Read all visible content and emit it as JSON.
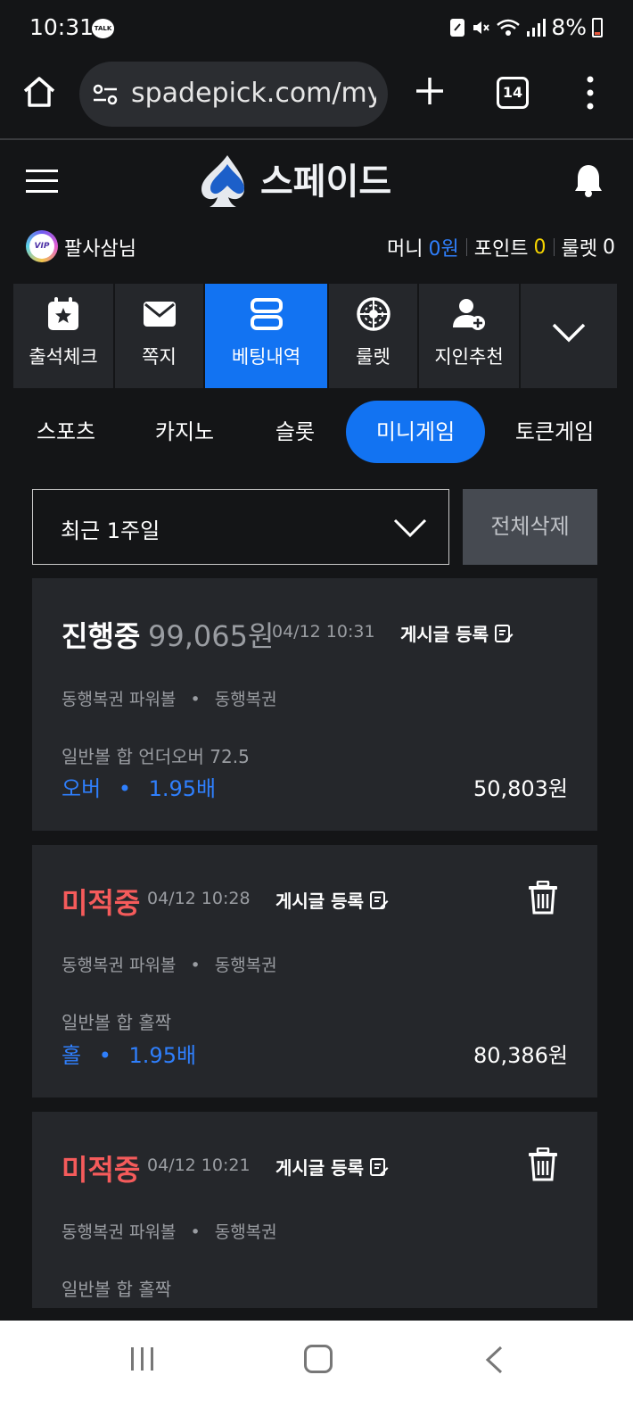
{
  "status_bar": {
    "time": "10:31",
    "talk_badge": "TALK",
    "battery": "8%"
  },
  "browser": {
    "url": "spadepick.com/my/l",
    "tab_count": "14"
  },
  "header": {
    "logo_text": "스페이드"
  },
  "user": {
    "vip_label": "VIP",
    "name": "팔사삼님",
    "money_label": "머니",
    "money_value": "0원",
    "points_label": "포인트",
    "points_value": "0",
    "roulette_label": "룰렛",
    "roulette_value": "0"
  },
  "quick_nav": {
    "items": [
      {
        "label": "출석체크",
        "icon": "calendar-star-icon"
      },
      {
        "label": "쪽지",
        "icon": "envelope-icon"
      },
      {
        "label": "베팅내역",
        "icon": "bet-history-icon",
        "active": true
      },
      {
        "label": "룰렛",
        "icon": "roulette-icon"
      },
      {
        "label": "지인추천",
        "icon": "add-user-icon"
      }
    ],
    "more_icon": "chevron-down-icon"
  },
  "sub_tabs": {
    "items": [
      "스포츠",
      "카지노",
      "슬롯",
      "미니게임",
      "토큰게임"
    ],
    "active": "미니게임"
  },
  "filter": {
    "period": "최근 1주일",
    "delete_all": "전체삭제"
  },
  "bets": [
    {
      "status": "진행중",
      "amount": "99,065원",
      "datetime": "04/12 10:31",
      "post_label": "게시글 등록",
      "game": "동행복권 파워볼",
      "game_sep": "•",
      "provider": "동행복권",
      "market": "일반볼 합 언더오버 72.5",
      "pick": "오버",
      "pick_sep": "•",
      "odds": "1.95배",
      "payout": "50,803원"
    },
    {
      "status": "미적중",
      "datetime": "04/12 10:28",
      "post_label": "게시글 등록",
      "game": "동행복권 파워볼",
      "game_sep": "•",
      "provider": "동행복권",
      "market": "일반볼 합 홀짝",
      "pick": "홀",
      "pick_sep": "•",
      "odds": "1.95배",
      "payout": "80,386원"
    },
    {
      "status": "미적중",
      "datetime": "04/12 10:21",
      "post_label": "게시글 등록",
      "game": "동행복권 파워볼",
      "game_sep": "•",
      "provider": "동행복권",
      "market": "일반볼 합 홀짝"
    }
  ],
  "colors": {
    "accent": "#1273f2",
    "miss": "#f55b5b",
    "points": "#f6d400",
    "card_bg": "#25272b",
    "page_bg": "#141517"
  }
}
